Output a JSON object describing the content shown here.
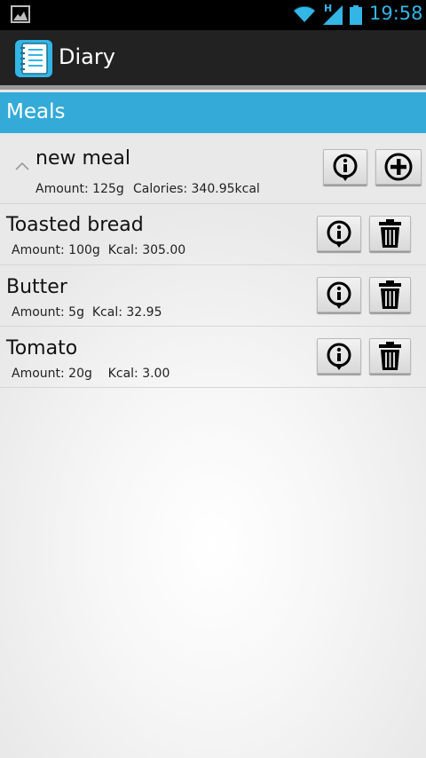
{
  "status_bar": {
    "time": "19:58",
    "network_type": "H",
    "icons": [
      "gallery-icon",
      "wifi-icon",
      "signal-icon",
      "battery-icon"
    ]
  },
  "action_bar": {
    "title": "Diary",
    "icon": "diary-notebook-icon"
  },
  "section": {
    "title": "Meals"
  },
  "meal": {
    "title": "new meal",
    "amount": "Amount: 125g",
    "calories": "Calories: 340.95kcal",
    "expanded_icon": "chevron-up-icon"
  },
  "items": [
    {
      "name": "Toasted bread",
      "detail": "Amount: 100g  Kcal: 305.00"
    },
    {
      "name": "Butter",
      "detail": "Amount: 5g  Kcal: 32.95"
    },
    {
      "name": "Tomato",
      "detail": "Amount: 20g    Kcal: 3.00"
    }
  ],
  "colors": {
    "accent": "#33b5e5",
    "section_header": "#33aad8",
    "action_bar": "#222222"
  }
}
